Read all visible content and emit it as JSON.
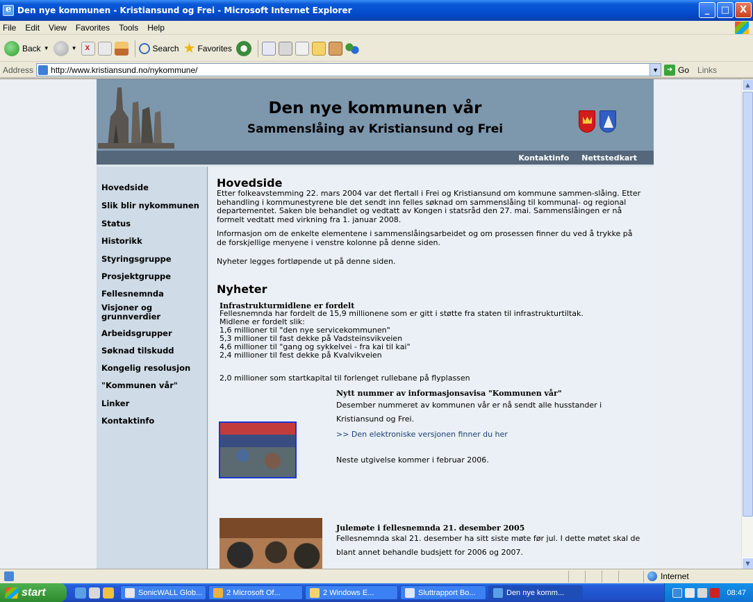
{
  "window": {
    "title": "Den nye kommunen - Kristiansund og Frei - Microsoft Internet Explorer",
    "controls": {
      "minimize": "_",
      "maximize": "□",
      "close": "X"
    }
  },
  "menu": [
    "File",
    "Edit",
    "View",
    "Favorites",
    "Tools",
    "Help"
  ],
  "toolbar": {
    "back": "Back",
    "search": "Search",
    "favorites": "Favorites"
  },
  "address": {
    "label": "Address",
    "url": "http://www.kristiansund.no/nykommune/",
    "go": "Go",
    "links": "Links"
  },
  "banner": {
    "title": "Den nye kommunen vår",
    "subtitle": "Sammenslåing av Kristiansund og Frei"
  },
  "topnav": [
    "Kontaktinfo",
    "Nettstedkart"
  ],
  "sidebar": [
    "Hovedside",
    "Slik blir nykommunen",
    "Status",
    "Historikk",
    "Styringsgruppe",
    "Prosjektgruppe",
    "Fellesnemnda",
    "Visjoner og grunnverdier",
    "Arbeidsgrupper",
    "Søknad tilskudd",
    "Kongelig resolusjon",
    "\"Kommunen vår\"",
    "Linker",
    "Kontaktinfo"
  ],
  "main": {
    "heading": "Hovedside",
    "intro": "Etter folkeavstemming 22. mars 2004 var det flertall i Frei og Kristiansund om kommune sammen-slåing. Etter behandling i kommunestyrene ble det sendt inn felles søknad om sammenslåing til kommunal- og regional departementet. Saken ble behandlet og vedtatt av Kongen i statsråd den 27. mai. Sammenslåingen er nå formelt vedtatt med virkning fra 1. januar 2008.",
    "intro2": "Informasjon om de enkelte elementene i sammenslåingsarbeidet og om prosessen finner du ved å trykke på de forskjellige menyene i venstre kolonne på denne siden.",
    "intro3": "Nyheter legges fortløpende ut på denne siden.",
    "news_heading": "Nyheter",
    "news": [
      {
        "title": "Infrastrukturmidlene er fordelt",
        "lines": [
          "Fellesnemnda har fordelt de 15,9 millionene som er gitt i støtte fra staten til infrastrukturtiltak.",
          "Midlene er fordelt slik:",
          "1,6 millioner til \"den nye servicekommunen\"",
          "5,3 millioner til fast dekke på Vadsteinsvikveien",
          "4,6 millioner til \"gang og sykkelvei - fra kai til kai\"",
          "2,4 millioner til fest dekke på Kvalvikveien"
        ],
        "extra": "2,0 millioner som startkapital til forlenget rullebane på flyplassen"
      },
      {
        "title": "Nytt nummer av informasjonsavisa \"Kommunen vår\"",
        "body": "Desember nummeret av kommunen vår er nå sendt alle husstander i Kristiansund og Frei.",
        "link": ">> Den elektroniske versjonen finner du her",
        "next": "Neste utgivelse kommer i februar 2006."
      },
      {
        "title": "Julemøte i fellesnemnda 21. desember 2005",
        "body": "Fellesnemnda skal 21. desember ha sitt siste møte før jul. I dette møtet skal de blant annet behandle budsjett for 2006 og 2007."
      }
    ]
  },
  "status": {
    "zone": "Internet"
  },
  "taskbar": {
    "start": "start",
    "tasks": [
      "SonicWALL Glob...",
      "2 Microsoft Of...",
      "2 Windows E...",
      "Sluttrapport Bo...",
      "Den nye komm..."
    ],
    "clock": "08:47"
  }
}
